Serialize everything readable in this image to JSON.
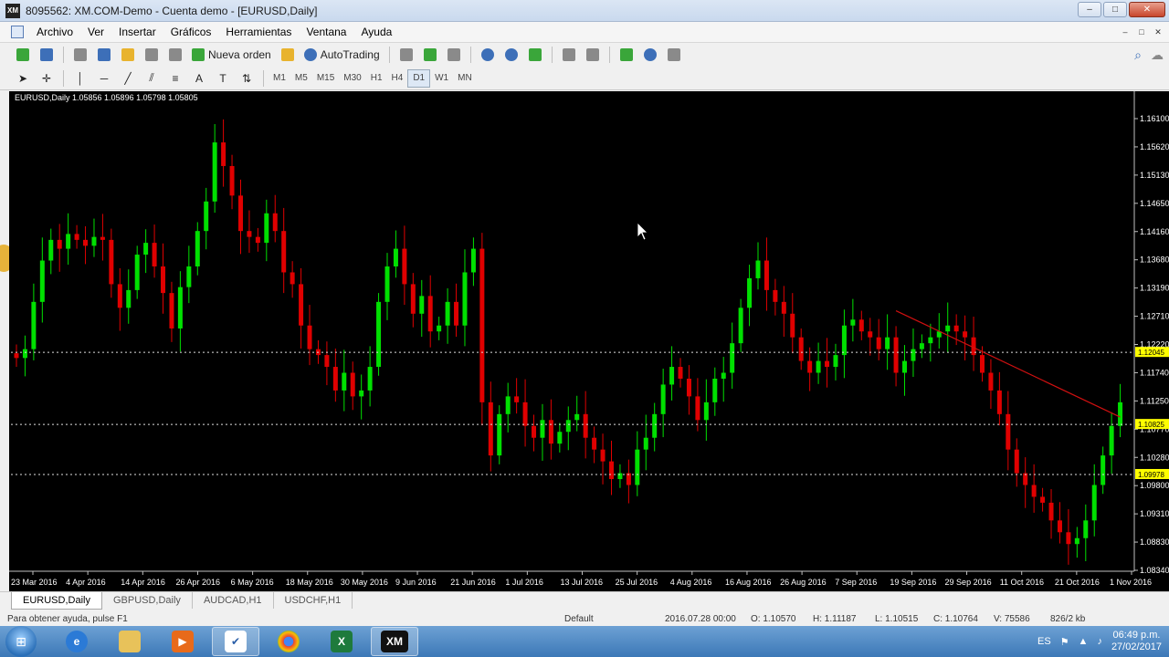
{
  "window": {
    "title": "8095562: XM.COM-Demo - Cuenta demo - [EURUSD,Daily]",
    "app_icon": "XM",
    "minimize": "–",
    "maximize": "□",
    "close": "✕"
  },
  "menu": {
    "items": [
      "Archivo",
      "Ver",
      "Insertar",
      "Gráficos",
      "Herramientas",
      "Ventana",
      "Ayuda"
    ]
  },
  "toolbar": {
    "new_order_label": "Nueva orden",
    "autotrading_label": "AutoTrading",
    "timeframes": [
      "M1",
      "M5",
      "M15",
      "M30",
      "H1",
      "H4",
      "D1",
      "W1",
      "MN"
    ],
    "active_timeframe": "D1"
  },
  "chart": {
    "header": "EURUSD,Daily  1.05856 1.05896 1.05798 1.05805",
    "price_labels": [
      "1.16100",
      "1.15620",
      "1.15130",
      "1.14650",
      "1.14160",
      "1.13680",
      "1.13190",
      "1.12710",
      "1.12220",
      "1.11740",
      "1.11250",
      "1.10770",
      "1.10280",
      "1.09800",
      "1.09310",
      "1.08830",
      "1.08340"
    ],
    "level_labels": [
      "1.12045",
      "1.10825",
      "1.09978"
    ],
    "date_labels": [
      "23 Mar 2016",
      "4 Apr 2016",
      "14 Apr 2016",
      "26 Apr 2016",
      "6 May 2016",
      "18 May 2016",
      "30 May 2016",
      "9 Jun 2016",
      "21 Jun 2016",
      "1 Jul 2016",
      "13 Jul 2016",
      "25 Jul 2016",
      "4 Aug 2016",
      "16 Aug 2016",
      "26 Aug 2016",
      "7 Sep 2016",
      "19 Sep 2016",
      "29 Sep 2016",
      "11 Oct 2016",
      "21 Oct 2016",
      "1 Nov 2016"
    ],
    "colors": {
      "bull": "#00e000",
      "bear": "#e00000",
      "level": "#ffff00",
      "trendline": "#d01010"
    }
  },
  "tabs": [
    "EURUSD,Daily",
    "GBPUSD,Daily",
    "AUDCAD,H1",
    "USDCHF,H1"
  ],
  "status": {
    "help": "Para obtener ayuda, pulse F1",
    "profile": "Default",
    "datetime": "2016.07.28 00:00",
    "open": "O: 1.10570",
    "high": "H: 1.11187",
    "low": "L: 1.10515",
    "close": "C: 1.10764",
    "volume": "V: 75586",
    "traffic": "826/2 kb"
  },
  "taskbar": {
    "language": "ES",
    "time": "06:49 p.m.",
    "date": "27/02/2017"
  },
  "chart_data": {
    "type": "candlestick",
    "symbol": "EURUSD",
    "timeframe": "Daily",
    "ylim": [
      1.0834,
      1.1625
    ],
    "levels": [
      1.12045,
      1.10825,
      1.09978
    ],
    "closes": [
      1.1195,
      1.121,
      1.129,
      1.136,
      1.1395,
      1.138,
      1.1405,
      1.1395,
      1.1385,
      1.14,
      1.1395,
      1.132,
      1.128,
      1.131,
      1.137,
      1.139,
      1.135,
      1.1305,
      1.1245,
      1.1315,
      1.135,
      1.141,
      1.146,
      1.156,
      1.152,
      1.147,
      1.141,
      1.14,
      1.139,
      1.144,
      1.141,
      1.134,
      1.132,
      1.125,
      1.121,
      1.12,
      1.118,
      1.114,
      1.117,
      1.113,
      1.114,
      1.118,
      1.129,
      1.135,
      1.138,
      1.132,
      1.127,
      1.13,
      1.124,
      1.125,
      1.129,
      1.125,
      1.134,
      1.138,
      1.112,
      1.103,
      1.11,
      1.113,
      1.112,
      1.108,
      1.106,
      1.109,
      1.105,
      1.107,
      1.109,
      1.11,
      1.106,
      1.104,
      1.102,
      1.099,
      1.1,
      1.098,
      1.104,
      1.106,
      1.11,
      1.115,
      1.118,
      1.116,
      1.113,
      1.109,
      1.112,
      1.116,
      1.117,
      1.122,
      1.128,
      1.133,
      1.136,
      1.131,
      1.129,
      1.127,
      1.123,
      1.119,
      1.117,
      1.119,
      1.118,
      1.12,
      1.125,
      1.126,
      1.124,
      1.123,
      1.121,
      1.123,
      1.117,
      1.119,
      1.121,
      1.122,
      1.123,
      1.124,
      1.125,
      1.124,
      1.123,
      1.12,
      1.117,
      1.114,
      1.11,
      1.104,
      1.1,
      1.098,
      1.096,
      1.095,
      1.092,
      1.09,
      1.088,
      1.089,
      1.092,
      1.098,
      1.103,
      1.108,
      1.112
    ]
  }
}
